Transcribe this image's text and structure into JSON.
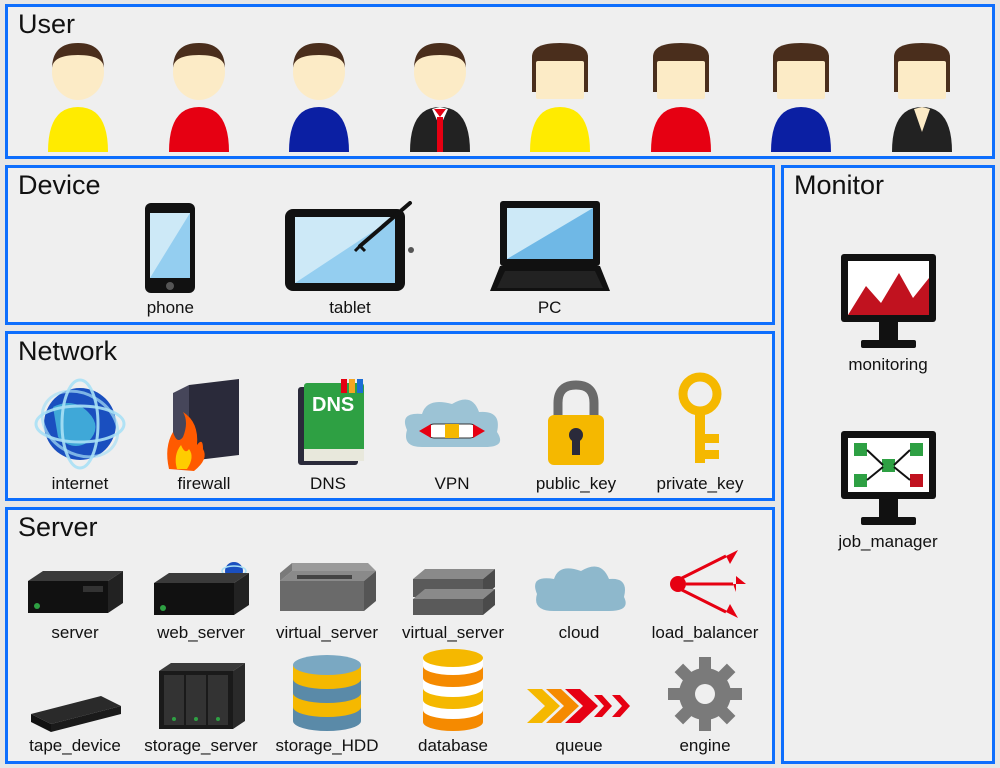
{
  "panels": {
    "user": {
      "title": "User"
    },
    "device": {
      "title": "Device"
    },
    "network": {
      "title": "Network"
    },
    "server": {
      "title": "Server"
    },
    "monitor": {
      "title": "Monitor"
    }
  },
  "users": [
    {
      "shirt": "#FFEB00",
      "hair": "short"
    },
    {
      "shirt": "#E60012",
      "hair": "short"
    },
    {
      "shirt": "#0B1FA3",
      "hair": "short"
    },
    {
      "shirt": "suit",
      "hair": "short"
    },
    {
      "shirt": "#FFEB00",
      "hair": "long"
    },
    {
      "shirt": "#E60012",
      "hair": "long"
    },
    {
      "shirt": "#0B1FA3",
      "hair": "long"
    },
    {
      "shirt": "suit2",
      "hair": "long"
    }
  ],
  "devices": [
    {
      "label": "phone"
    },
    {
      "label": "tablet"
    },
    {
      "label": "PC"
    }
  ],
  "network": [
    {
      "label": "internet"
    },
    {
      "label": "firewall"
    },
    {
      "label": "DNS"
    },
    {
      "label": "VPN"
    },
    {
      "label": "public_key"
    },
    {
      "label": "private_key"
    }
  ],
  "server": [
    {
      "label": "server"
    },
    {
      "label": "web_server"
    },
    {
      "label": "virtual_server"
    },
    {
      "label": "virtual_server"
    },
    {
      "label": "cloud"
    },
    {
      "label": "load_balancer"
    },
    {
      "label": "tape_device"
    },
    {
      "label": "storage_server"
    },
    {
      "label": "storage_HDD"
    },
    {
      "label": "database"
    },
    {
      "label": "queue"
    },
    {
      "label": "engine"
    }
  ],
  "monitor": [
    {
      "label": "monitoring"
    },
    {
      "label": "job_manager"
    }
  ],
  "colors": {
    "border": "#0d6efd",
    "skin": "#FCEBC6",
    "hair": "#4A2E1C"
  }
}
